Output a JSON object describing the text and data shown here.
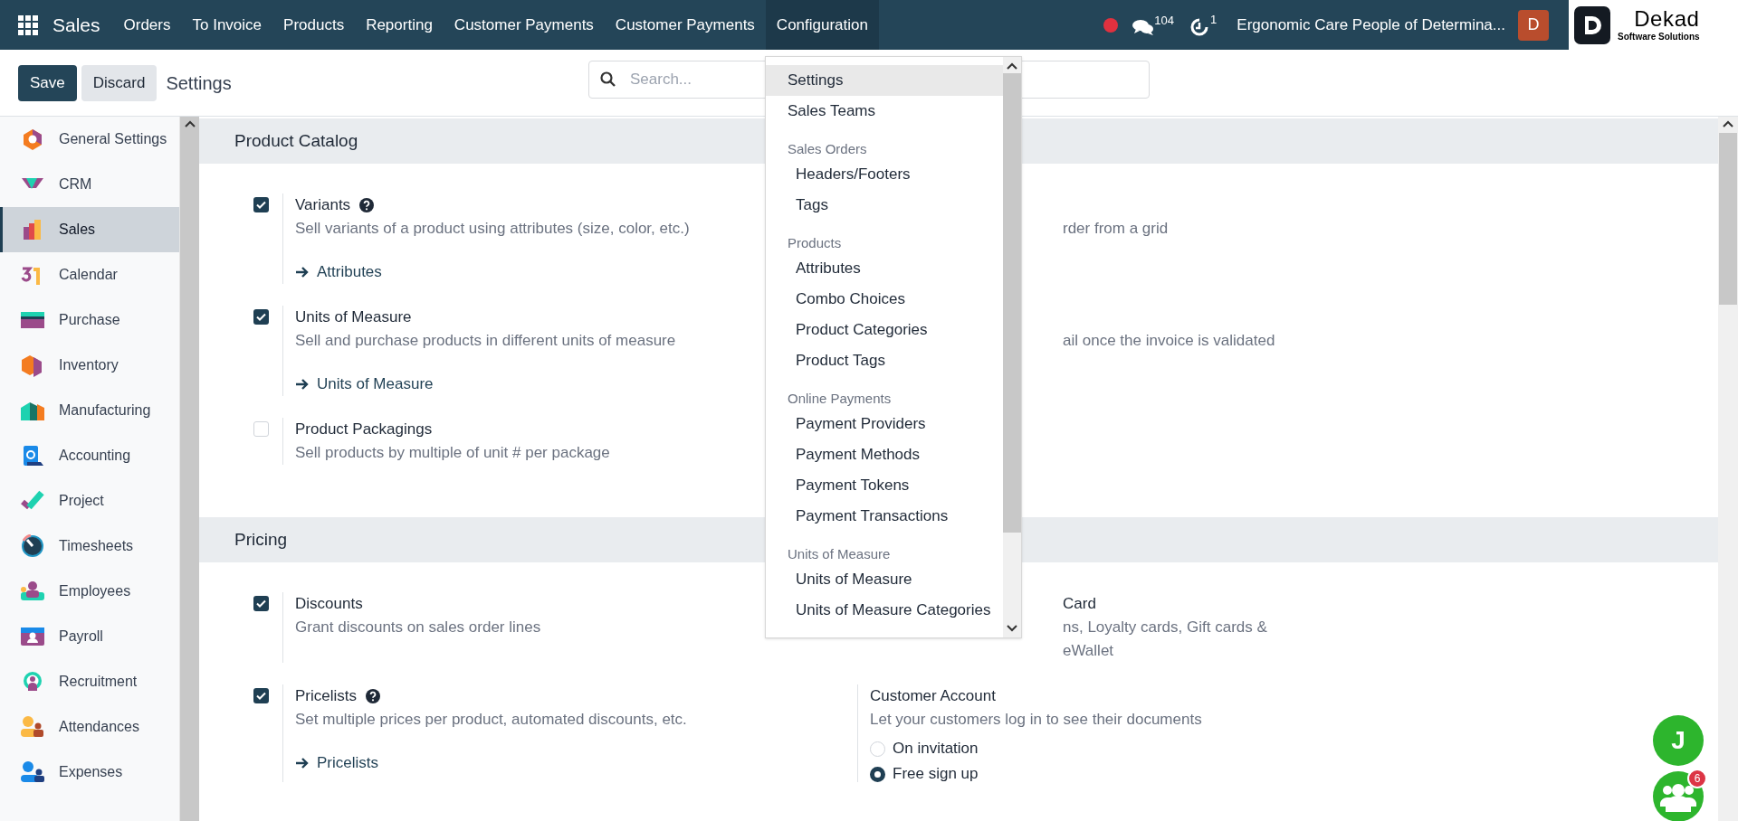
{
  "topbar": {
    "app_name": "Sales",
    "menu": [
      {
        "label": "Orders",
        "selected": false
      },
      {
        "label": "To Invoice",
        "selected": false
      },
      {
        "label": "Products",
        "selected": false
      },
      {
        "label": "Reporting",
        "selected": false
      },
      {
        "label": "Customer Payments",
        "selected": false
      },
      {
        "label": "Customer Payments",
        "selected": false
      },
      {
        "label": "Configuration",
        "selected": true
      }
    ],
    "chat_count": "104",
    "activity_count": "1",
    "company": "Ergonomic Care People of Determina...",
    "avatar": "D",
    "logo": {
      "name": "Dekad",
      "tagline": "Software Solutions"
    }
  },
  "control_panel": {
    "save": "Save",
    "discard": "Discard",
    "breadcrumb": "Settings",
    "search": {
      "placeholder": "Search..."
    }
  },
  "sidebar": {
    "items": [
      {
        "label": "General Settings",
        "selected": false
      },
      {
        "label": "CRM",
        "selected": false
      },
      {
        "label": "Sales",
        "selected": true
      },
      {
        "label": "Calendar",
        "selected": false
      },
      {
        "label": "Purchase",
        "selected": false
      },
      {
        "label": "Inventory",
        "selected": false
      },
      {
        "label": "Manufacturing",
        "selected": false
      },
      {
        "label": "Accounting",
        "selected": false
      },
      {
        "label": "Project",
        "selected": false
      },
      {
        "label": "Timesheets",
        "selected": false
      },
      {
        "label": "Employees",
        "selected": false
      },
      {
        "label": "Payroll",
        "selected": false
      },
      {
        "label": "Recruitment",
        "selected": false
      },
      {
        "label": "Attendances",
        "selected": false
      },
      {
        "label": "Expenses",
        "selected": false
      }
    ]
  },
  "sections": [
    {
      "title": "Product Catalog",
      "rows": [
        {
          "left": {
            "title": "Variants",
            "help": true,
            "checked": true,
            "description": "Sell variants of a product using attributes (size, color, etc.)",
            "link": "Attributes"
          },
          "right": {
            "clipped": true,
            "description": "rder from a grid"
          }
        },
        {
          "left": {
            "title": "Units of Measure",
            "help": false,
            "checked": true,
            "description": "Sell and purchase products in different units of measure",
            "link": "Units of Measure"
          },
          "right": {
            "clipped": true,
            "description": "ail once the invoice is validated"
          }
        },
        {
          "left": {
            "title": "Product Packagings",
            "help": false,
            "checked": false,
            "description": "Sell products by multiple of unit # per package"
          }
        }
      ]
    },
    {
      "title": "Pricing",
      "rows": [
        {
          "left": {
            "title": "Discounts",
            "help": false,
            "checked": true,
            "description": "Grant discounts on sales order lines"
          },
          "right": {
            "clipped": true,
            "title": "Card",
            "description": "ns, Loyalty cards, Gift cards & eWallet"
          }
        },
        {
          "left": {
            "title": "Pricelists",
            "help": true,
            "checked": true,
            "description": "Set multiple prices per product, automated discounts, etc.",
            "link": "Pricelists"
          },
          "right": {
            "title": "Customer Account",
            "description": "Let your customers log in to see their documents",
            "options": [
              {
                "label": "On invitation",
                "selected": false
              },
              {
                "label": "Free sign up",
                "selected": true
              }
            ]
          }
        }
      ]
    }
  ],
  "config_menu": {
    "items": [
      {
        "kind": "item",
        "label": "Settings",
        "selected": true
      },
      {
        "kind": "item",
        "label": "Sales Teams",
        "selected": false
      },
      {
        "kind": "group",
        "label": "Sales Orders",
        "children": [
          {
            "label": "Headers/Footers",
            "selected": false
          },
          {
            "label": "Tags",
            "selected": false
          }
        ]
      },
      {
        "kind": "group",
        "label": "Products",
        "children": [
          {
            "label": "Attributes",
            "selected": false
          },
          {
            "label": "Combo Choices",
            "selected": false
          },
          {
            "label": "Product Categories",
            "selected": false
          },
          {
            "label": "Product Tags",
            "selected": false
          }
        ]
      },
      {
        "kind": "group",
        "label": "Online Payments",
        "children": [
          {
            "label": "Payment Providers",
            "selected": false
          },
          {
            "label": "Payment Methods",
            "selected": false
          },
          {
            "label": "Payment Tokens",
            "selected": false
          },
          {
            "label": "Payment Transactions",
            "selected": false
          }
        ]
      },
      {
        "kind": "group",
        "label": "Units of Measure",
        "children": [
          {
            "label": "Units of Measure",
            "selected": false
          },
          {
            "label": "Units of Measure Categories",
            "selected": false
          }
        ]
      }
    ]
  },
  "floating": {
    "avatar": "J",
    "badge": "6"
  }
}
